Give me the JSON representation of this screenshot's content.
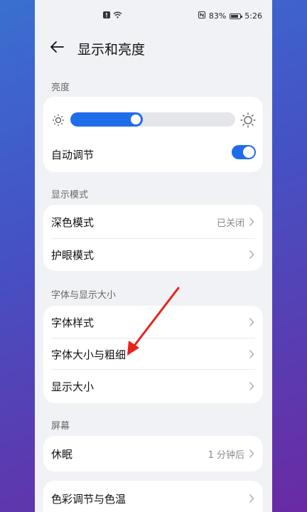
{
  "status_bar": {
    "battery_percent": "83%",
    "time": "5:26"
  },
  "header": {
    "title": "显示和亮度"
  },
  "brightness_section": {
    "label": "亮度",
    "level": 0.44,
    "auto_label": "自动调节",
    "auto_on": true
  },
  "display_mode_section": {
    "label": "显示模式",
    "items": [
      {
        "label": "深色模式",
        "value": "已关闭"
      },
      {
        "label": "护眼模式",
        "value": ""
      }
    ]
  },
  "font_section": {
    "label": "字体与显示大小",
    "items": [
      {
        "label": "字体样式"
      },
      {
        "label": "字体大小与粗细"
      },
      {
        "label": "显示大小"
      }
    ]
  },
  "screen_section": {
    "label": "屏幕",
    "items": [
      {
        "label": "休眠",
        "value": "1 分钟后"
      },
      {
        "label": "色彩调节与色温",
        "value": ""
      }
    ]
  },
  "colors": {
    "accent": "#1f6dea",
    "annotation_arrow": "#e8221b"
  }
}
